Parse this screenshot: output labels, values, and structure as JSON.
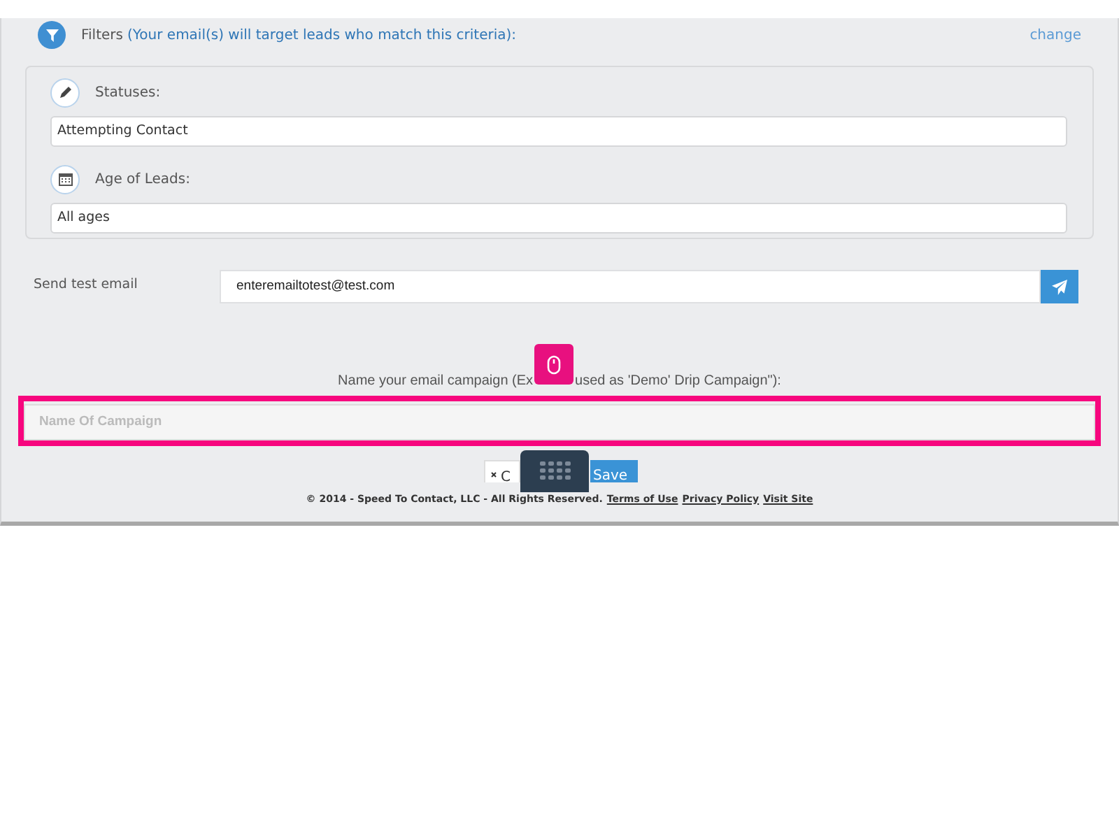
{
  "filters": {
    "title": "Filters",
    "subtitle": "(Your email(s) will target leads who match this criteria):",
    "change_link": "change",
    "items": [
      {
        "kind": "status",
        "label": "Statuses:",
        "value": "Attempting Contact"
      },
      {
        "kind": "age",
        "label": "Age of Leads:",
        "value": "All ages"
      }
    ]
  },
  "test_email": {
    "label": "Send test email",
    "value": "enteremailtotest@test.com"
  },
  "campaign": {
    "label_start": "Name your email campaign (Ex",
    "label_end": "used as 'Demo' Drip Campaign\"):",
    "placeholder": "Name Of Campaign",
    "highlighted": true
  },
  "buttons": {
    "cancel": "C",
    "save": "Save"
  },
  "footer": {
    "text": "© 2014 - Speed To Contact, LLC - All Rights Reserved.",
    "links": [
      "Terms of Use",
      "Privacy Policy",
      "Visit Site"
    ]
  }
}
